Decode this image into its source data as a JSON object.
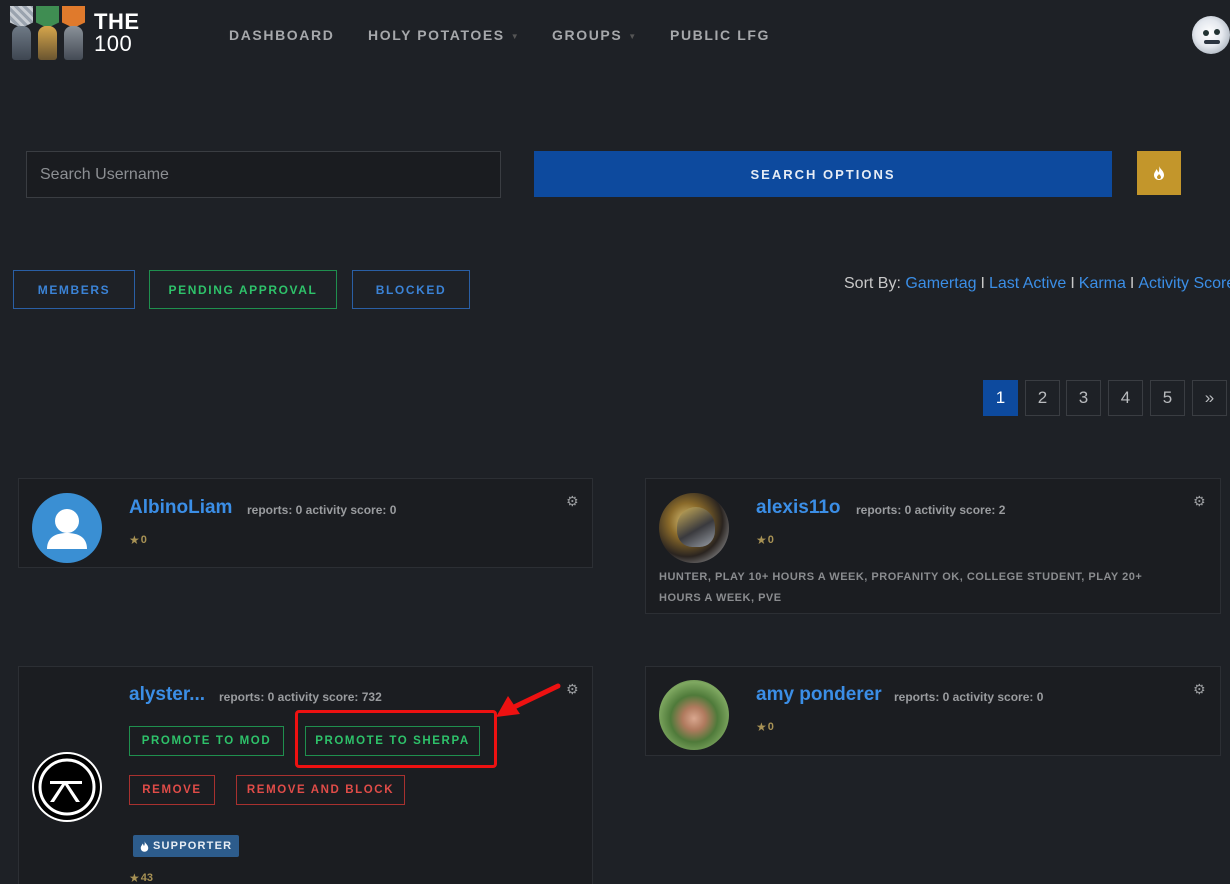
{
  "nav": {
    "logo_line1": "THE",
    "logo_line2": "100",
    "items": [
      {
        "label": "DASHBOARD",
        "dropdown": false
      },
      {
        "label": "HOLY POTATOES",
        "dropdown": true
      },
      {
        "label": "GROUPS",
        "dropdown": true
      },
      {
        "label": "PUBLIC LFG",
        "dropdown": false
      }
    ]
  },
  "search": {
    "placeholder": "Search Username",
    "options_label": "SEARCH OPTIONS"
  },
  "tabs": {
    "members": "MEMBERS",
    "pending": "PENDING APPROVAL",
    "blocked": "BLOCKED"
  },
  "sort": {
    "label": "Sort By:",
    "options": [
      "Gamertag",
      "Last Active",
      "Karma",
      "Activity Score"
    ],
    "separator": "I"
  },
  "pagination": {
    "pages": [
      "1",
      "2",
      "3",
      "4",
      "5"
    ],
    "next": "»",
    "current": 1
  },
  "members": [
    {
      "name": "AlbinoLiam",
      "meta": "reports: 0 activity score: 0",
      "karma": "0",
      "tags": ""
    },
    {
      "name": "alexis11o",
      "meta": "reports: 0 activity score: 2",
      "karma": "0",
      "tags_line1": "HUNTER, PLAY 10+ HOURS A WEEK, PROFANITY OK, COLLEGE STUDENT, PLAY 20+",
      "tags_line2": "HOURS A WEEK, PVE"
    },
    {
      "name": "alyster...",
      "meta": "reports: 0 activity score: 732",
      "karma": "43",
      "badge": "SUPPORTER",
      "actions": {
        "promote_mod": "PROMOTE TO MOD",
        "promote_sherpa": "PROMOTE TO SHERPA",
        "remove": "REMOVE",
        "remove_block": "REMOVE AND BLOCK"
      }
    },
    {
      "name": "amy ponderer",
      "meta": "reports: 0 activity score: 0",
      "karma": "0"
    }
  ],
  "colors": {
    "background": "#1e2126",
    "card": "#1b1d21",
    "primary_blue": "#0d4a9e",
    "link_blue": "#3b8ee6",
    "green": "#2ec26a",
    "red": "#e04c48",
    "gold": "#c3962b",
    "annotation_red": "#ee1111"
  },
  "icons": {
    "fire": "flame-icon",
    "gear": "gear-icon",
    "star": "star-icon",
    "user": "user-silhouette-icon"
  }
}
